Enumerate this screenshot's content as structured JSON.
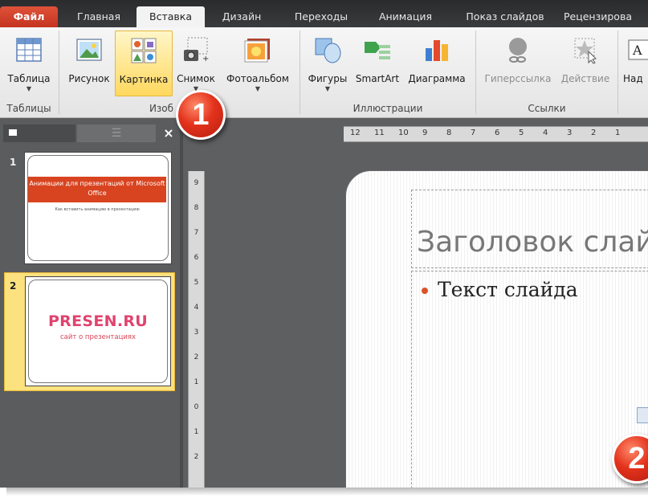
{
  "tabs": {
    "file": "Файл",
    "home": "Главная",
    "insert": "Вставка",
    "design": "Дизайн",
    "transitions": "Переходы",
    "animation": "Анимация",
    "slideshow": "Показ слайдов",
    "review": "Рецензирова"
  },
  "ribbon": {
    "table": "Таблица",
    "picture": "Рисунок",
    "clipart": "Картинка",
    "screenshot": "Снимок",
    "photoalbum": "Фотоальбом",
    "shapes": "Фигуры",
    "smartart": "SmartArt",
    "chart": "Диаграмма",
    "hyperlink": "Гиперссылка",
    "action": "Действие",
    "textbox": "Над",
    "group_tables": "Таблицы",
    "group_images": "Изоб",
    "group_illustrations": "Иллюстрации",
    "group_links": "Ссылки"
  },
  "slides_pane": {
    "close": "×",
    "slide1": {
      "number": "1",
      "title": "Анимации для презентаций от Microsoft Office",
      "subtitle": "Как вставить анимацию в презентацию"
    },
    "slide2": {
      "number": "2",
      "logo": "PRESEN.RU",
      "subtitle": "сайт о презентациях"
    }
  },
  "hruler": [
    "12",
    "11",
    "10",
    "9",
    "8",
    "7",
    "6",
    "5",
    "4",
    "3",
    "2",
    "1"
  ],
  "vruler": [
    "9",
    "8",
    "7",
    "6",
    "5",
    "4",
    "3",
    "2",
    "1",
    "0",
    "1",
    "2"
  ],
  "slide": {
    "title_placeholder": "Заголовок слай",
    "body_text": "Текст слайда"
  },
  "callouts": {
    "one": "1",
    "two": "2"
  },
  "colors": {
    "accent": "#d84420",
    "file_tab": "#c4331f",
    "selected_button": "#ffd85e",
    "logo_pink": "#e0436e"
  }
}
